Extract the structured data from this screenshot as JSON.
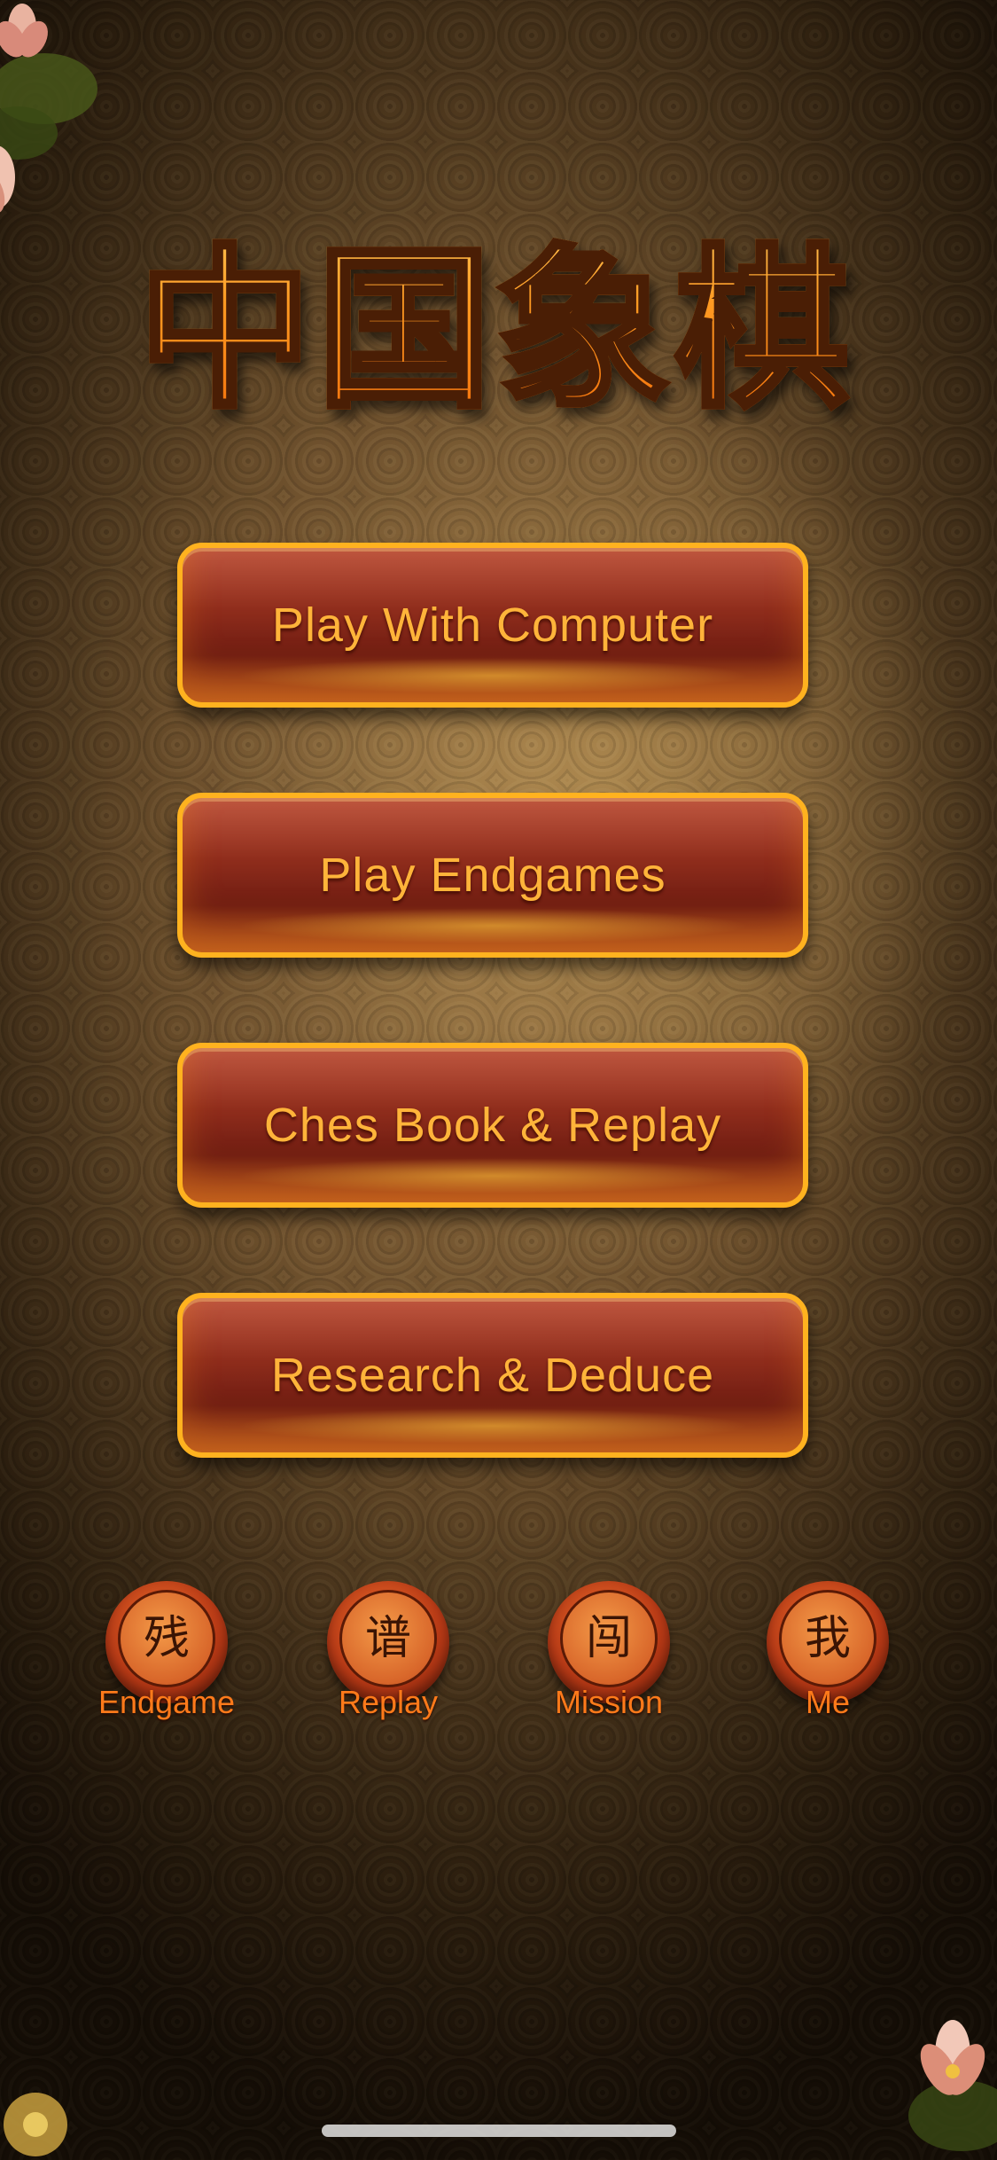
{
  "title": {
    "text": "中国象棋"
  },
  "menu": {
    "buttons": [
      {
        "label": "Play With Computer"
      },
      {
        "label": "Play Endgames"
      },
      {
        "label": "Ches Book & Replay"
      },
      {
        "label": "Research & Deduce"
      }
    ]
  },
  "bottom_nav": {
    "items": [
      {
        "glyph": "残",
        "label": "Endgame"
      },
      {
        "glyph": "谱",
        "label": "Replay"
      },
      {
        "glyph": "闯",
        "label": "Mission"
      },
      {
        "glyph": "我",
        "label": "Me"
      }
    ]
  },
  "colors": {
    "accent": "#ff9a22",
    "button_border": "#ffb21f",
    "button_fill": "#8a2a1a",
    "label_text": "#ffb43a"
  }
}
